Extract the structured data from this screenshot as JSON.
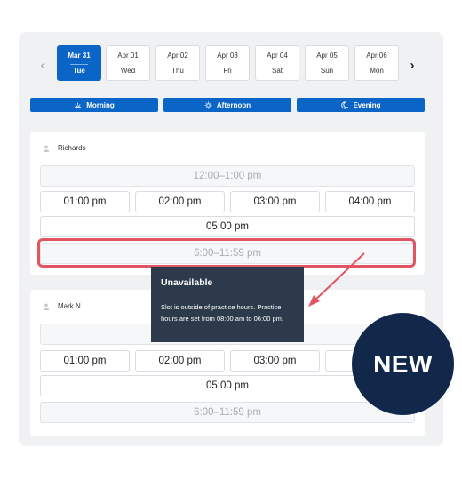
{
  "dates": [
    {
      "date": "Mar 31",
      "day": "Tue",
      "selected": true
    },
    {
      "date": "Apr 01",
      "day": "Wed"
    },
    {
      "date": "Apr 02",
      "day": "Thu"
    },
    {
      "date": "Apr 03",
      "day": "Fri"
    },
    {
      "date": "Apr 04",
      "day": "Sat"
    },
    {
      "date": "Apr 05",
      "day": "Sun"
    },
    {
      "date": "Apr 06",
      "day": "Mon"
    }
  ],
  "nav": {
    "prev": "‹",
    "next": "›"
  },
  "periods": [
    "Morning",
    "Afternoon",
    "Evening"
  ],
  "staff": [
    {
      "name": "Richards",
      "top_slot": "12:00–1:00 pm",
      "slots": [
        "01:00 pm",
        "02:00 pm",
        "03:00 pm",
        "04:00 pm"
      ],
      "wide_slot": "05:00 pm",
      "late_slot": "6:00–11:59 pm"
    },
    {
      "name": "Mark N",
      "slots": [
        "01:00 pm",
        "02:00 pm",
        "03:00 pm"
      ],
      "wide_slot": "05:00 pm",
      "late_slot": "6:00–11:59 pm"
    }
  ],
  "tooltip": {
    "title": "Unavailable",
    "text": "Slot is outside of practice hours. Practice hours are set from 08:00 am to 06:00 pm."
  },
  "badge": "NEW",
  "colors": {
    "accent": "#0b65c7",
    "highlight": "#e05561",
    "tooltip_bg": "#2c3a4b",
    "badge_bg": "#12284b"
  }
}
